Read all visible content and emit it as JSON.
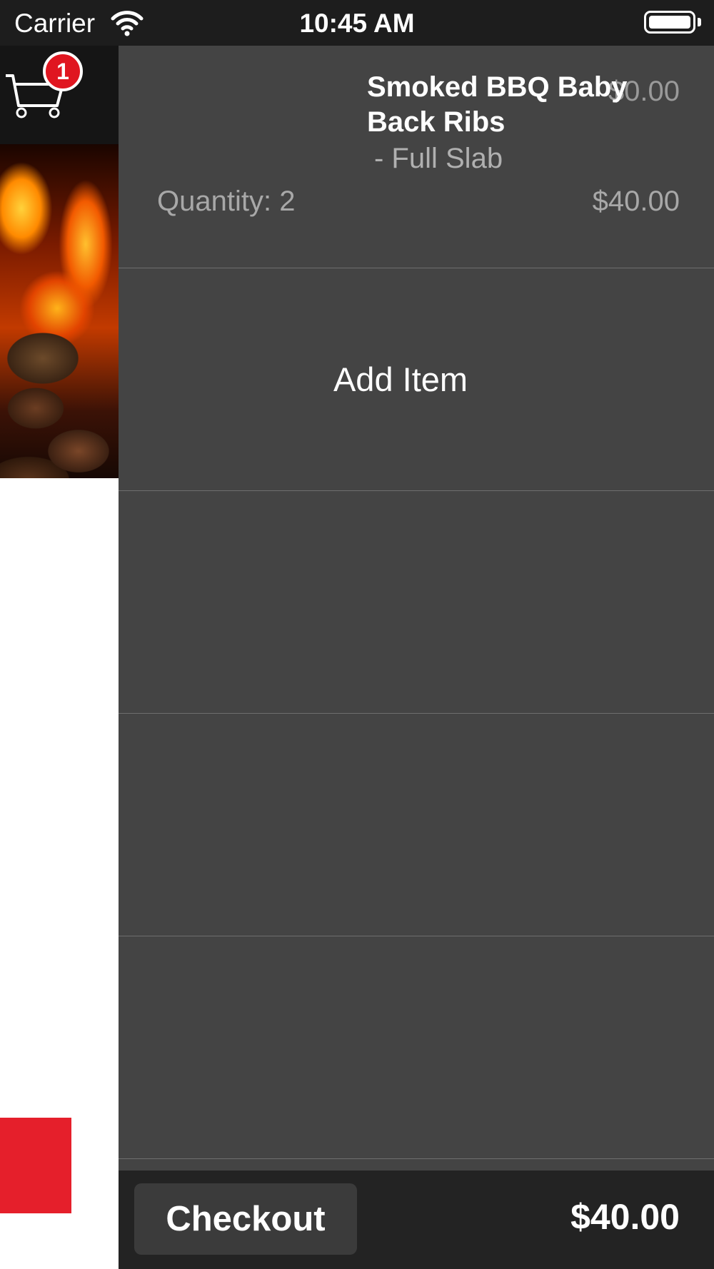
{
  "status_bar": {
    "carrier": "Carrier",
    "time": "10:45 AM",
    "wifi_icon": "wifi-icon",
    "battery_icon": "battery-icon"
  },
  "left_app": {
    "cart_icon": "cart-icon",
    "cart_badge": "1",
    "accent_color": "#e51f2b"
  },
  "cart": {
    "items": [
      {
        "name": "Smoked BBQ Baby Back Ribs",
        "unit_price": "$0.00",
        "option": "- Full Slab",
        "quantity": "Quantity: 2",
        "total": "$40.00"
      }
    ],
    "add_item_label": "Add Item"
  },
  "checkout": {
    "button_label": "Checkout",
    "total": "$40.00"
  },
  "colors": {
    "panel_bg": "#444444",
    "footer_bg": "#232323",
    "badge": "#e01620"
  }
}
